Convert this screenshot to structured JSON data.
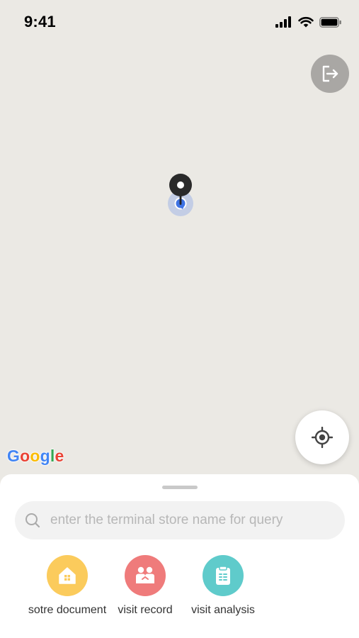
{
  "status_bar": {
    "time": "9:41"
  },
  "map": {
    "attribution": {
      "G": "G",
      "o1": "o",
      "o2": "o",
      "g": "g",
      "l": "l",
      "e": "e"
    },
    "colors": {
      "g_blue": "#4285F4",
      "g_red": "#EA4335",
      "g_yellow": "#FBBC05",
      "g_green": "#34A853"
    }
  },
  "search": {
    "placeholder": "enter the terminal store name for query",
    "value": ""
  },
  "shortcuts": [
    {
      "label": "sotre document",
      "icon": "house-icon",
      "color": "#fbcb5c"
    },
    {
      "label": "visit record",
      "icon": "people-icon",
      "color": "#ef7b7b"
    },
    {
      "label": "visit analysis",
      "icon": "clipboard-icon",
      "color": "#5fcbcb"
    }
  ]
}
